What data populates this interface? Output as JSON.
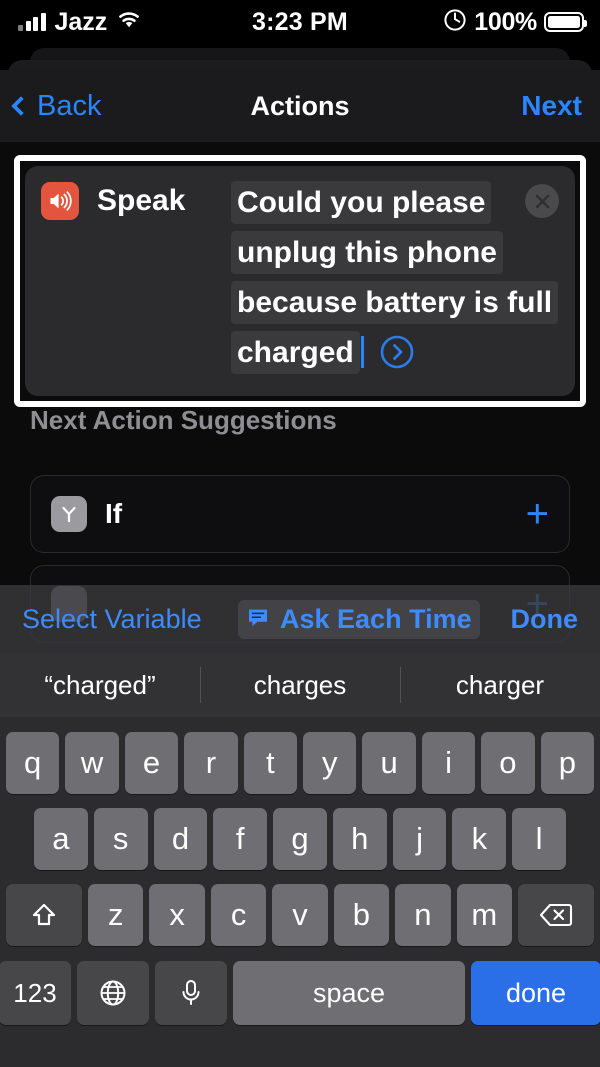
{
  "status_bar": {
    "carrier": "Jazz",
    "time": "3:23 PM",
    "battery_percent": "100%",
    "wifi_icon": "wifi-icon",
    "signal_icon": "cellular-signal-icon",
    "orientation_lock_icon": "rotation-lock-icon",
    "battery_icon": "battery-icon"
  },
  "nav": {
    "back_label": "Back",
    "title": "Actions",
    "next_label": "Next"
  },
  "action": {
    "icon": "speaker-wave-icon",
    "icon_color": "#e4553f",
    "name": "Speak",
    "text_value": "Could you please unplug this phone because battery is full charged",
    "close_icon": "close-circle-icon",
    "run_icon": "chevron-right-circle-icon",
    "focused": true
  },
  "suggestions": {
    "header": "Next Action Suggestions",
    "items": [
      {
        "icon": "branch-if-icon",
        "label": "If",
        "add_icon": "plus-icon"
      },
      {
        "icon": "action-icon",
        "label": "",
        "add_icon": "plus-icon"
      }
    ]
  },
  "keyboard": {
    "accessory": {
      "select_variable": "Select Variable",
      "ask_each_time": "Ask Each Time",
      "ask_icon": "speech-bubble-icon",
      "done": "Done"
    },
    "predictions": [
      "“charged”",
      "charges",
      "charger"
    ],
    "rows": {
      "row1": [
        "q",
        "w",
        "e",
        "r",
        "t",
        "y",
        "u",
        "i",
        "o",
        "p"
      ],
      "row2": [
        "a",
        "s",
        "d",
        "f",
        "g",
        "h",
        "j",
        "k",
        "l"
      ],
      "row3": [
        "z",
        "x",
        "c",
        "v",
        "b",
        "n",
        "m"
      ]
    },
    "shift_icon": "shift-icon",
    "backspace_icon": "backspace-icon",
    "numbers_key": "123",
    "globe_icon": "globe-icon",
    "mic_icon": "microphone-icon",
    "space_key": "space",
    "done_key": "done"
  },
  "colors": {
    "accent_blue": "#2b85ff",
    "keyboard_blue": "#2b6fe8",
    "speak_red": "#e4553f",
    "muted_gray": "#8e8e93"
  }
}
